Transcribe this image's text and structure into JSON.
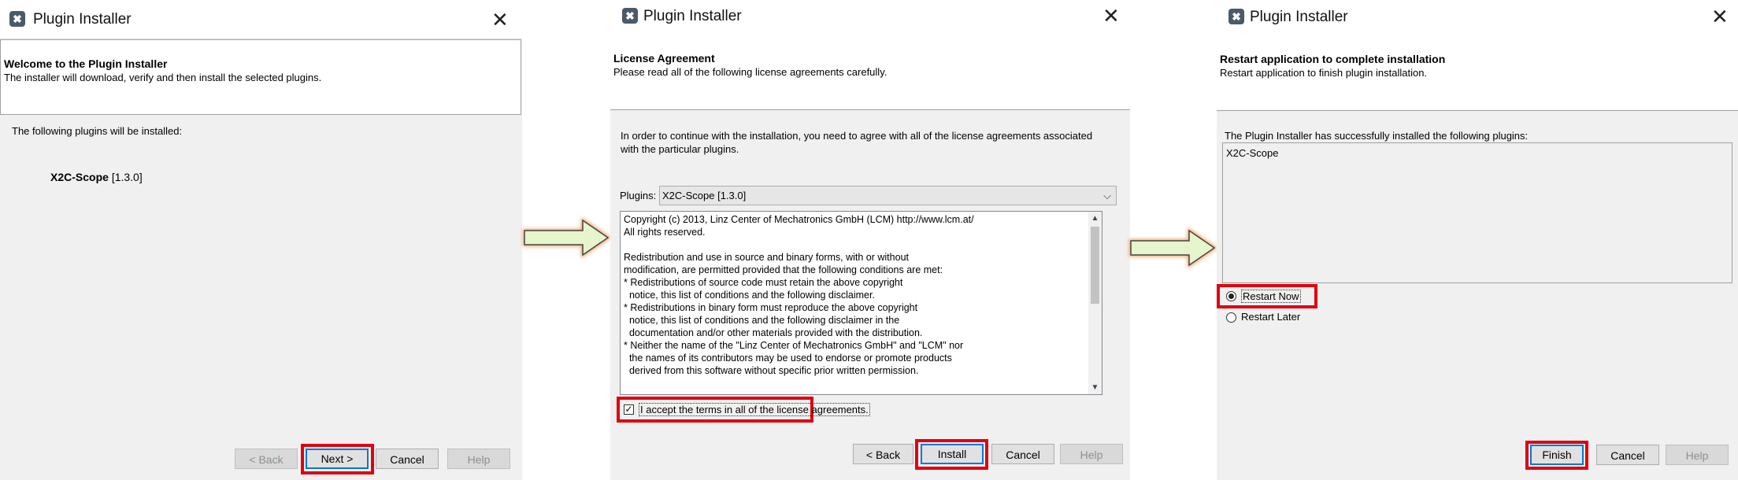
{
  "colors": {
    "highlight": "#e00010",
    "accent": "#0078d7",
    "arrow_fill": "#e6f5cc",
    "arrow_glow": "#f0a060"
  },
  "icons": {
    "app": "plugin-installer-icon",
    "close": "close-icon",
    "flow": "right-arrow-icon"
  },
  "dialog1": {
    "title": "Plugin Installer",
    "close": "✕",
    "header_title": "Welcome to the Plugin Installer",
    "header_desc": "The installer will download, verify and then install the selected plugins.",
    "intro": "The following plugins will be installed:",
    "plugin_name": "X2C-Scope",
    "plugin_version": "[1.3.0]",
    "buttons": {
      "back": "< Back",
      "next": "Next >",
      "cancel": "Cancel",
      "help": "Help"
    }
  },
  "dialog2": {
    "title": "Plugin Installer",
    "close": "✕",
    "header_title": "License Agreement",
    "header_desc": "Please read all of the following license agreements carefully.",
    "intro_line1": "In order to continue with the installation, you need to agree with all of the license agreements associated",
    "intro_line2": "with the particular plugins.",
    "plugins_label": "Plugins:",
    "plugins_value": "X2C-Scope [1.3.0]",
    "license_lines": [
      "Copyright (c) 2013, Linz Center of Mechatronics GmbH (LCM) http://www.lcm.at/",
      "All rights reserved.",
      "",
      "Redistribution and use in source and binary forms, with or without",
      "modification, are permitted provided that the following conditions are met:",
      "* Redistributions of source code must retain the above copyright",
      "  notice, this list of conditions and the following disclaimer.",
      "* Redistributions in binary form must reproduce the above copyright",
      "  notice, this list of conditions and the following disclaimer in the",
      "  documentation and/or other materials provided with the distribution.",
      "* Neither the name of the \"Linz Center of Mechatronics GmbH\" and \"LCM\" nor",
      "  the names of its contributors may be used to endorse or promote products",
      "  derived from this software without specific prior written permission."
    ],
    "accept_check": "✓",
    "accept_label": "I accept the terms in all of the license agreements.",
    "buttons": {
      "back": "< Back",
      "install": "Install",
      "cancel": "Cancel",
      "help": "Help"
    }
  },
  "dialog3": {
    "title": "Plugin Installer",
    "close": "✕",
    "header_title": "Restart application to complete installation",
    "header_desc": "Restart application to finish plugin installation.",
    "intro": "The Plugin Installer has successfully installed the following plugins:",
    "installed": [
      "X2C-Scope"
    ],
    "restart_now": "Restart Now",
    "restart_later": "Restart Later",
    "buttons": {
      "finish": "Finish",
      "cancel": "Cancel",
      "help": "Help"
    }
  }
}
